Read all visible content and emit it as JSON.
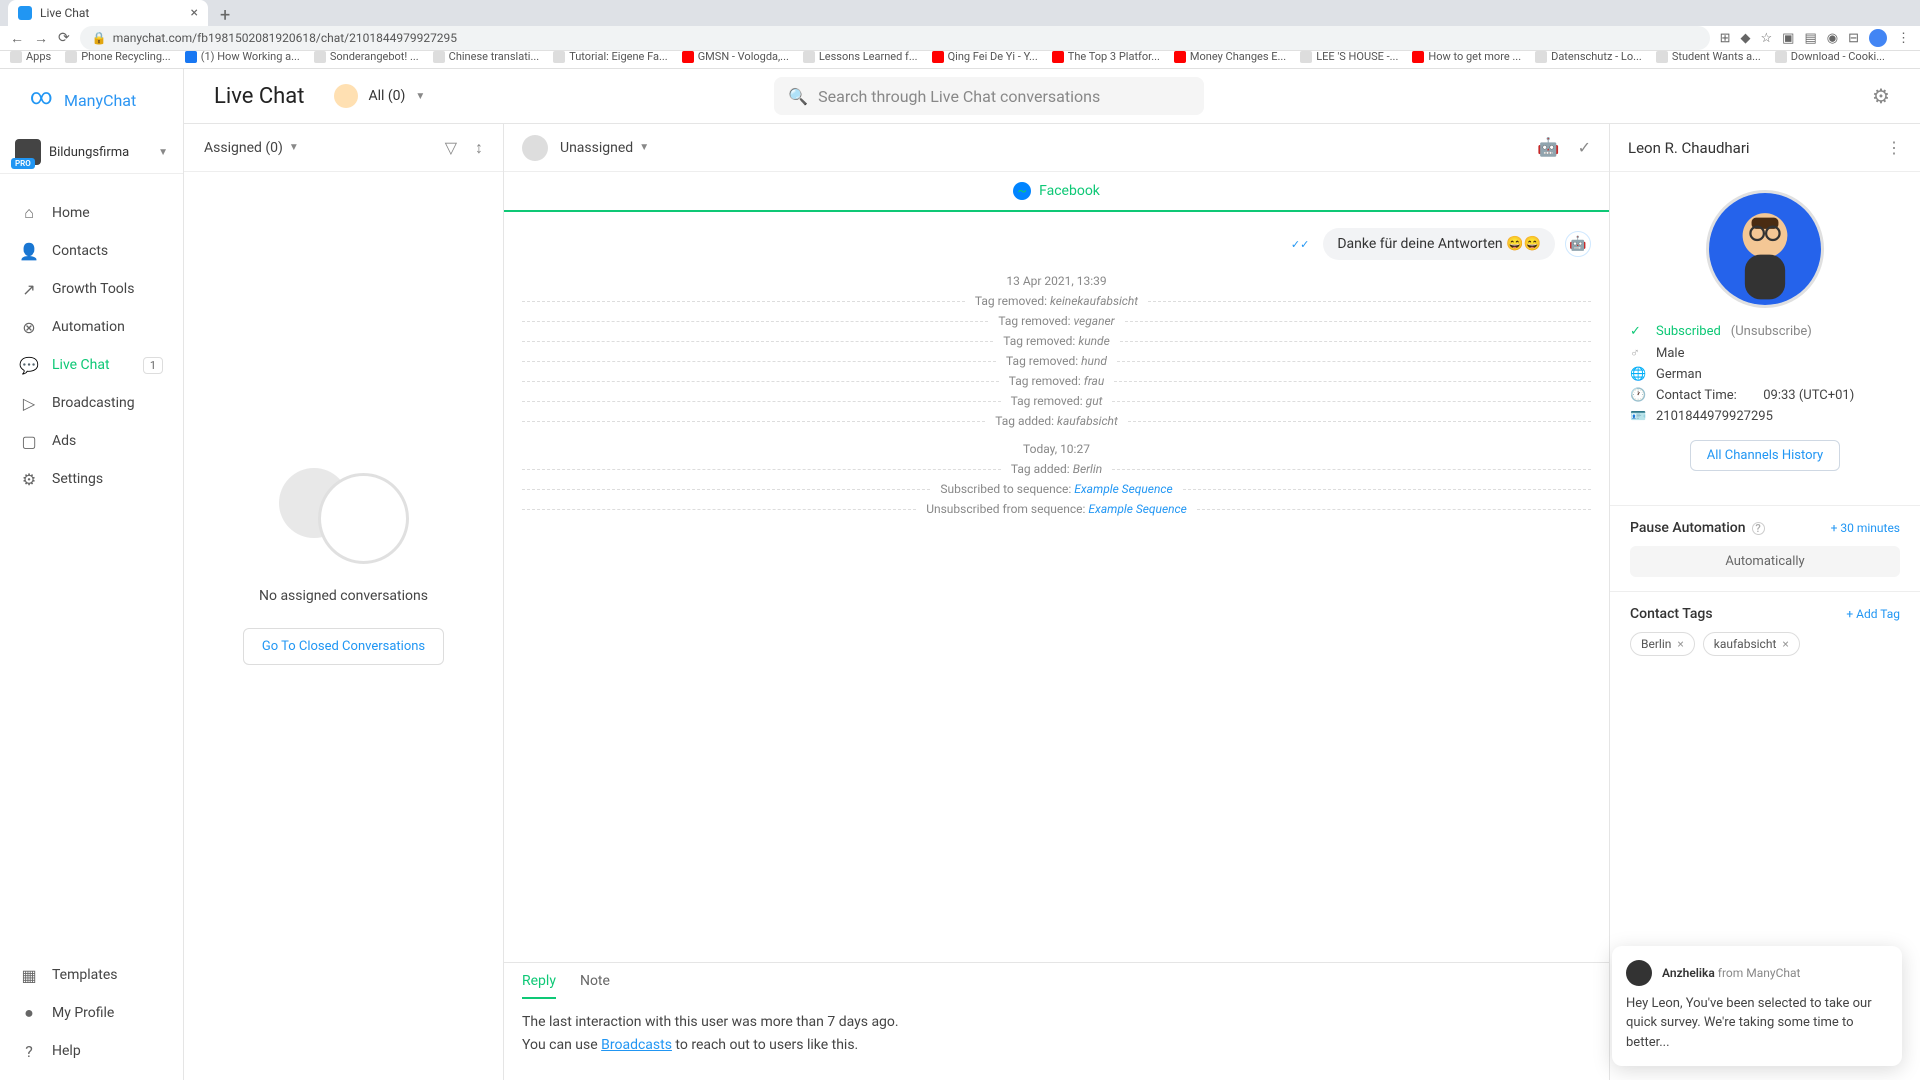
{
  "browser": {
    "tab_title": "Live Chat",
    "url": "manychat.com/fb198150208192061​8/chat/2101844979927295",
    "bookmarks": [
      "Apps",
      "Phone Recycling...",
      "(1) How Working a...",
      "Sonderangebot! ...",
      "Chinese translati...",
      "Tutorial: Eigene Fa...",
      "GMSN - Vologda,...",
      "Lessons Learned f...",
      "Qing Fei De Yi - Y...",
      "The Top 3 Platfor...",
      "Money Changes E...",
      "LEE 'S HOUSE -...",
      "How to get more ...",
      "Datenschutz - Lo...",
      "Student Wants a...",
      "Download - Cooki..."
    ]
  },
  "brand": "ManyChat",
  "workspace": {
    "name": "Bildungsfirma",
    "badge": "PRO"
  },
  "nav": {
    "home": "Home",
    "contacts": "Contacts",
    "growth": "Growth Tools",
    "automation": "Automation",
    "livechat": "Live Chat",
    "livechat_badge": "1",
    "broadcasting": "Broadcasting",
    "ads": "Ads",
    "settings": "Settings",
    "templates": "Templates",
    "profile": "My Profile",
    "help": "Help"
  },
  "header": {
    "title": "Live Chat",
    "channel_filter": "All (0)",
    "search_placeholder": "Search through Live Chat conversations"
  },
  "list": {
    "assigned_dd": "Assigned (0)",
    "empty_text": "No assigned conversations",
    "closed_btn": "Go To Closed Conversations"
  },
  "conversation": {
    "assignee": "Unassigned",
    "channel": "Facebook",
    "bubble": "Danke für deine Antworten 😄😄",
    "timestamp1": "13 Apr 2021, 13:39",
    "events": [
      {
        "prefix": "Tag removed: ",
        "value": "keinekaufabsicht"
      },
      {
        "prefix": "Tag removed: ",
        "value": "veganer"
      },
      {
        "prefix": "Tag removed: ",
        "value": "kunde"
      },
      {
        "prefix": "Tag removed: ",
        "value": "hund"
      },
      {
        "prefix": "Tag removed: ",
        "value": "frau"
      },
      {
        "prefix": "Tag removed: ",
        "value": "gut"
      },
      {
        "prefix": "Tag added: ",
        "value": "kaufabsicht"
      }
    ],
    "timestamp2": "Today, 10:27",
    "events2": [
      {
        "prefix": "Tag added: ",
        "value": "Berlin"
      }
    ],
    "seq_sub": "Subscribed to sequence: ",
    "seq_unsub": "Unsubscribed from sequence: ",
    "seq_name": "Example Sequence",
    "tabs": {
      "reply": "Reply",
      "note": "Note"
    },
    "warn1": "The last interaction with this user was more than 7 days ago.",
    "warn2a": "You can use ",
    "warn2link": "Broadcasts",
    "warn2b": " to reach out to users like this."
  },
  "contact": {
    "name": "Leon R. Chaudhari",
    "subscribed": "Subscribed",
    "unsubscribe": "(Unsubscribe)",
    "gender": "Male",
    "locale": "German",
    "contact_time_label": "Contact Time:",
    "contact_time_value": "09:33 (UTC+01)",
    "id": "2101844979927295",
    "history_btn": "All Channels History",
    "pause": {
      "title": "Pause Automation",
      "plus": "+ 30 minutes",
      "auto": "Automatically"
    },
    "tags": {
      "title": "Contact Tags",
      "add": "+ Add Tag",
      "items": [
        "Berlin",
        "kaufabsicht"
      ]
    }
  },
  "popup": {
    "name": "Anzhelika",
    "from": "from ManyChat",
    "msg": "Hey Leon,  You've been selected to take our quick survey. We're taking some time to better..."
  }
}
